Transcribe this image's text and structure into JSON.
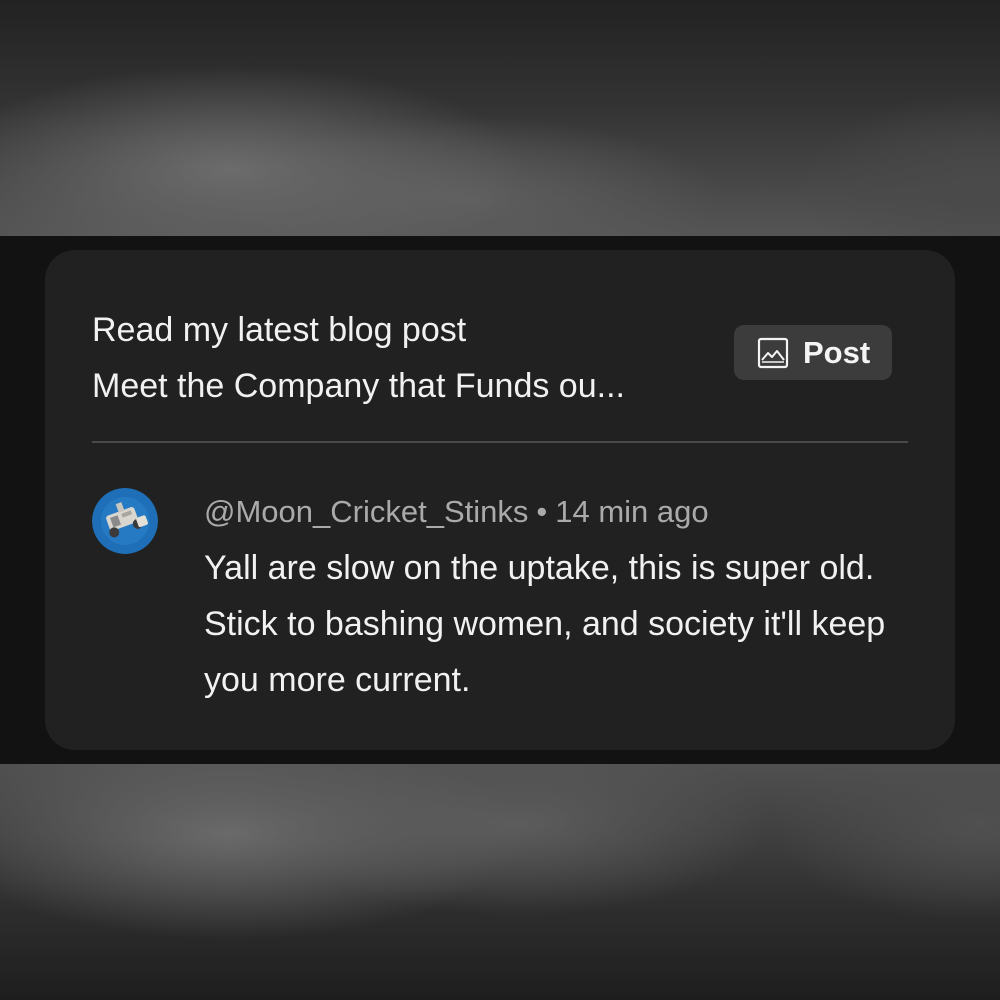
{
  "blog_promo": {
    "line1": "Read my latest blog post",
    "line2": "Meet the Company that Funds ou...",
    "post_button_label": "Post",
    "post_button_icon": "image-icon"
  },
  "comment": {
    "author": "@Moon_Cricket_Stinks",
    "separator": "•",
    "time": "14 min ago",
    "text": "Yall are slow on the uptake, this is super old. Stick to bashing women, and society it'll keep you more current."
  },
  "colors": {
    "card_background": "#212121",
    "strip_background": "#121212",
    "button_background": "#3c3c3c",
    "primary_text": "#f1f1f1",
    "secondary_text": "#aaaaaa",
    "avatar_blue": "#1e6fb8"
  }
}
